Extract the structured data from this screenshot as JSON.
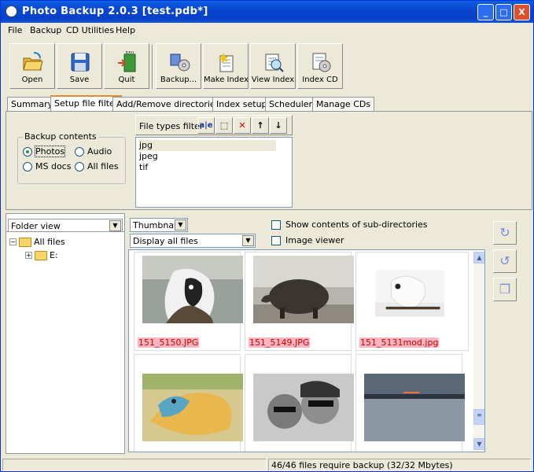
{
  "window": {
    "title": "Photo Backup 2.0.3  [test.pdb*]",
    "controls": [
      "_",
      "□",
      "X"
    ]
  },
  "menu": [
    "File",
    "Backup",
    "CD Utilities",
    "Help"
  ],
  "toolbar": [
    {
      "label": "Open",
      "icon": "open-folder-icon"
    },
    {
      "label": "Save",
      "icon": "floppy-disk-icon"
    },
    {
      "label": "Quit",
      "icon": "exit-door-icon"
    },
    {
      "label": "Backup...",
      "icon": "backup-icon"
    },
    {
      "label": "Make Index",
      "icon": "make-index-icon"
    },
    {
      "label": "View Index",
      "icon": "view-index-icon"
    },
    {
      "label": "Index CD",
      "icon": "index-cd-icon"
    }
  ],
  "tabs": [
    "Summary",
    "Setup file filter",
    "Add/Remove directories",
    "Index setup",
    "Scheduler",
    "Manage CDs"
  ],
  "active_tab": "Setup file filter",
  "backup_contents": {
    "title": "Backup contents",
    "options": [
      {
        "label": "Photos",
        "selected": true
      },
      {
        "label": "Audio",
        "selected": false
      },
      {
        "label": "MS docs",
        "selected": false
      },
      {
        "label": "All files",
        "selected": false
      }
    ]
  },
  "file_types": {
    "label": "File types filter",
    "buttons": [
      "a|e",
      "⬚",
      "✕",
      "↑",
      "↓"
    ],
    "items": [
      "jpg",
      "jpeg",
      "tif"
    ]
  },
  "folder_view": {
    "select": "Folder view",
    "tree": [
      {
        "label": "All files",
        "expanded": true
      },
      {
        "label": "E:",
        "expanded": false
      }
    ]
  },
  "view": {
    "mode": "Thumbnails",
    "filter": "Display all files",
    "show_subdirs_label": "Show contents of sub-directories",
    "image_viewer_label": "Image viewer"
  },
  "thumbnails": [
    {
      "caption": "151_5150.JPG",
      "subject": "llama"
    },
    {
      "caption": "151_5149.JPG",
      "subject": "pig"
    },
    {
      "caption": "151_5131mod.jpg",
      "subject": "cockatoo"
    },
    {
      "caption": "",
      "subject": "lizard"
    },
    {
      "caption": "",
      "subject": "kids"
    },
    {
      "caption": "",
      "subject": "sunset"
    }
  ],
  "status": {
    "message": "46/46 files require backup (32/32 Mbytes)"
  },
  "colors": {
    "titlebar": "#0a46d0",
    "caption_bg": "#ffb6c1",
    "caption_fg": "#cc0000",
    "window_bg": "#ece9d8"
  }
}
